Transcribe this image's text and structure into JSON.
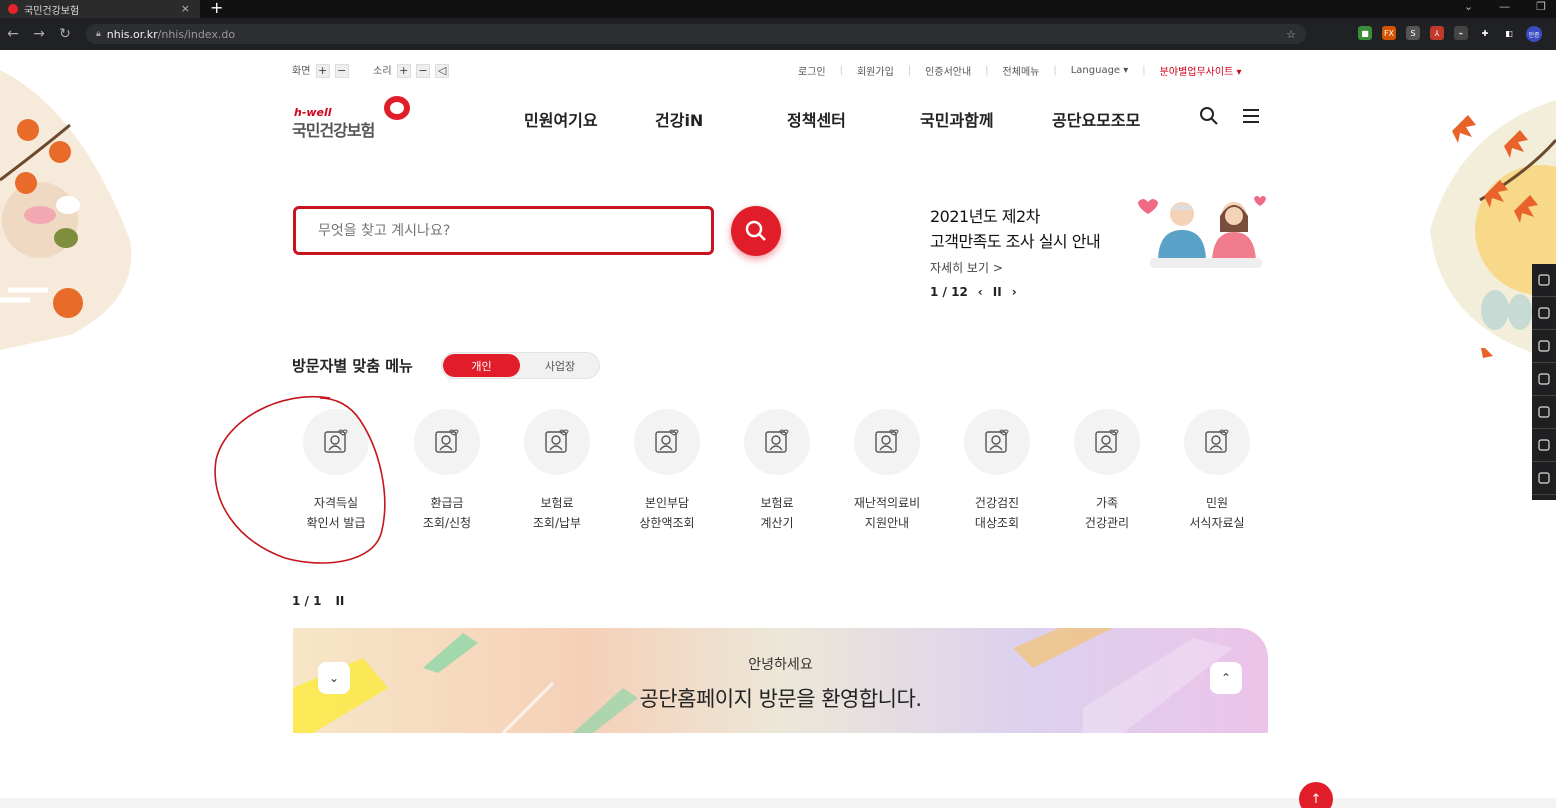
{
  "browser": {
    "tab_title": "국민건강보험",
    "tab_close": "×",
    "new_tab": "+",
    "url_host": "nhis.or.kr",
    "url_path": "/nhis/index.do",
    "window_controls": [
      "⌄",
      "—",
      "❐"
    ],
    "extensions": [
      {
        "name": "green-ext-icon",
        "color": "#3a8d3a",
        "text": "■"
      },
      {
        "name": "fx-ext-icon",
        "color": "#d35400",
        "text": "FX"
      },
      {
        "name": "s-ext-icon",
        "color": "#555555",
        "text": "S"
      },
      {
        "name": "pdf-ext-icon",
        "color": "#c0392b",
        "text": "⅄"
      },
      {
        "name": "eye-ext-icon",
        "color": "#444444",
        "text": "⌁"
      },
      {
        "name": "puzzle-ext-icon",
        "color": "#202124",
        "text": "✚"
      },
      {
        "name": "sidepanel-icon",
        "color": "#202124",
        "text": "◧"
      },
      {
        "name": "profile-avatar",
        "color": "#3b4cc0",
        "text": "인증"
      }
    ]
  },
  "utility": {
    "screen_label": "화면",
    "sound_label": "소리",
    "plus": "+",
    "minus": "−",
    "speaker": "◁"
  },
  "top_links": {
    "login": "로그인",
    "signup": "회원가입",
    "cert": "인증서안내",
    "all_menu": "전체메뉴",
    "language": "Language ▾",
    "affiliate": "분야별업무사이트 ▾"
  },
  "logo": {
    "sub": "h-well",
    "main": "국민건강보험"
  },
  "gnb": [
    "민원여기요",
    "건강iN",
    "정책센터",
    "국민과함께",
    "공단요모조모"
  ],
  "search": {
    "placeholder": "무엇을 찾고 계시나요?"
  },
  "notice": {
    "title_line1": "2021년도 제2차",
    "title_line2": "고객만족도 조사 실시 안내",
    "more": "자세히 보기 >",
    "pager": "1 / 12"
  },
  "visitor_menu": {
    "title": "방문자별 맞춤 메뉴",
    "tab_personal": "개인",
    "tab_business": "사업장"
  },
  "quick_menu": [
    {
      "label": "자격득실\n확인서 발급"
    },
    {
      "label": "환급금\n조회/신청"
    },
    {
      "label": "보험료\n조회/납부"
    },
    {
      "label": "본인부담\n상한액조회"
    },
    {
      "label": "보험료\n계산기"
    },
    {
      "label": "재난적의료비\n지원안내"
    },
    {
      "label": "건강검진\n대상조회"
    },
    {
      "label": "가족\n건강관리"
    },
    {
      "label": "민원\n서식자료실"
    }
  ],
  "quick_pager": "1 / 1",
  "pause": "II",
  "banner": {
    "small": "안녕하세요",
    "big": "공단홈페이지 방문을 환영합니다."
  },
  "colors": {
    "brand": "#e11d2a"
  }
}
